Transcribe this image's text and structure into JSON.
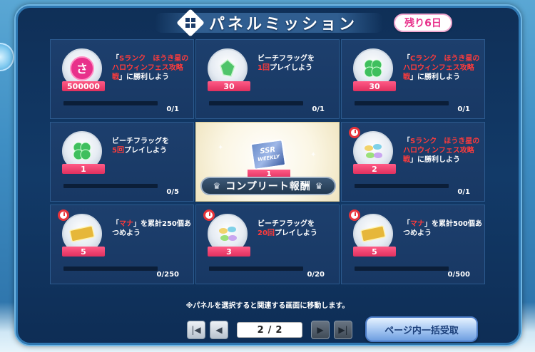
{
  "header": {
    "title": "パネルミッション",
    "days_left": "残り6日"
  },
  "panels": [
    {
      "id": "p1",
      "desc_prefix": "「",
      "desc_red": "Sランク　ほうき星のハロウィンフェス攻略戦",
      "desc_suffix": "」に勝利しよう",
      "qty": "500000",
      "progress": "0/1",
      "icon": "gem-icon",
      "timed": false
    },
    {
      "id": "p2",
      "desc_prefix": "ビーチフラッグを",
      "desc_red": "1回",
      "desc_suffix": "プレイしよう",
      "qty": "30",
      "progress": "0/1",
      "icon": "green-crystal-icon",
      "timed": false
    },
    {
      "id": "p3",
      "desc_prefix": "「",
      "desc_red": "Cランク　ほうき星のハロウィンフェス攻略戦",
      "desc_suffix": "」に勝利しよう",
      "qty": "30",
      "progress": "0/1",
      "icon": "clover-icon",
      "timed": false
    },
    {
      "id": "p4",
      "desc_prefix": "ビーチフラッグを",
      "desc_red": "5回",
      "desc_suffix": "プレイしよう",
      "qty": "1",
      "progress": "0/5",
      "icon": "clover-icon",
      "timed": false
    },
    {
      "id": "p6",
      "desc_prefix": "「",
      "desc_red": "Sランク　ほうき星のハロウィンフェス攻略戦",
      "desc_suffix": "」に勝利しよう",
      "qty": "2",
      "progress": "0/1",
      "icon": "gems-icon",
      "timed": true
    },
    {
      "id": "p7",
      "desc_prefix": "「",
      "desc_red": "マナ",
      "desc_suffix": "」を累計250個あつめよう",
      "qty": "5",
      "progress": "0/250",
      "icon": "ticket-icon",
      "timed": true
    },
    {
      "id": "p8",
      "desc_prefix": "ビーチフラッグを",
      "desc_red": "20回",
      "desc_suffix": "プレイしよう",
      "qty": "3",
      "progress": "0/20",
      "icon": "gems-icon",
      "timed": true
    },
    {
      "id": "p9",
      "desc_prefix": "「",
      "desc_red": "マナ",
      "desc_suffix": "」を累計500個あつめよう",
      "qty": "5",
      "progress": "0/500",
      "icon": "ticket-icon",
      "timed": true
    }
  ],
  "center": {
    "ticket_line1": "SSR",
    "ticket_line2": "WEEKLY",
    "qty": "1",
    "complete_label": "コンプリート報酬"
  },
  "notice": "※パネルを選択すると関連する画面に移動します。",
  "pager": {
    "current": "2",
    "separator": "/",
    "total": "2"
  },
  "claim_button": "ページ内一括受取"
}
